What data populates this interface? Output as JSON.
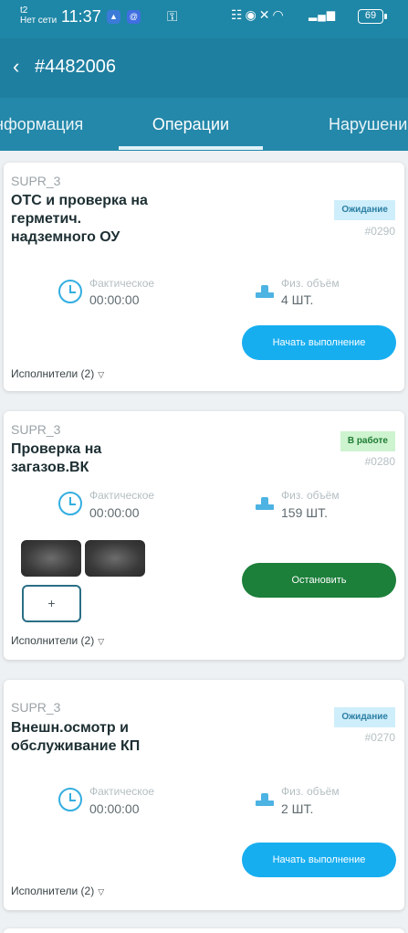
{
  "status_bar": {
    "carrier": "t2",
    "network": "Нет сети",
    "time": "11:37",
    "battery": "69"
  },
  "header": {
    "title": "#4482006"
  },
  "tabs": [
    {
      "label": "нформация"
    },
    {
      "label": "Операции"
    },
    {
      "label": "Нарушени"
    }
  ],
  "operations": [
    {
      "code": "SUPR_3",
      "title": "ОТС и проверка на герметич. надземного ОУ",
      "status": "Ожидание",
      "number": "#0290",
      "time_label": "Фактическое",
      "time_value": "00:00:00",
      "volume_label": "Физ. объём",
      "volume_value": "4 ШТ.",
      "action": "Начать выполнение",
      "executors": "Исполнители (2)"
    },
    {
      "code": "SUPR_3",
      "title": "Проверка на загазов.ВК",
      "status": "В работе",
      "number": "#0280",
      "time_label": "Фактическое",
      "time_value": "00:00:00",
      "volume_label": "Физ. объём",
      "volume_value": "159 ШТ.",
      "add_photo": "+",
      "action": "Остановить",
      "executors": "Исполнители (2)"
    },
    {
      "code": "SUPR_3",
      "title": "Внешн.осмотр и обслуживание КП",
      "status": "Ожидание",
      "number": "#0270",
      "time_label": "Фактическое",
      "time_value": "00:00:00",
      "volume_label": "Физ. объём",
      "volume_value": "2 ШТ.",
      "action": "Начать выполнение",
      "executors": "Исполнители (2)"
    }
  ],
  "icons": {
    "back": "chevron-left-icon",
    "time": "clock-icon",
    "volume": "volume-icon",
    "expand": "triangle-down-icon"
  },
  "colors": {
    "header": "#1f7fa0",
    "start_button": "#17aef0",
    "stop_button": "#1c7f3a",
    "status_wait_bg": "#cfeefb",
    "status_work_bg": "#cdf3cf"
  }
}
